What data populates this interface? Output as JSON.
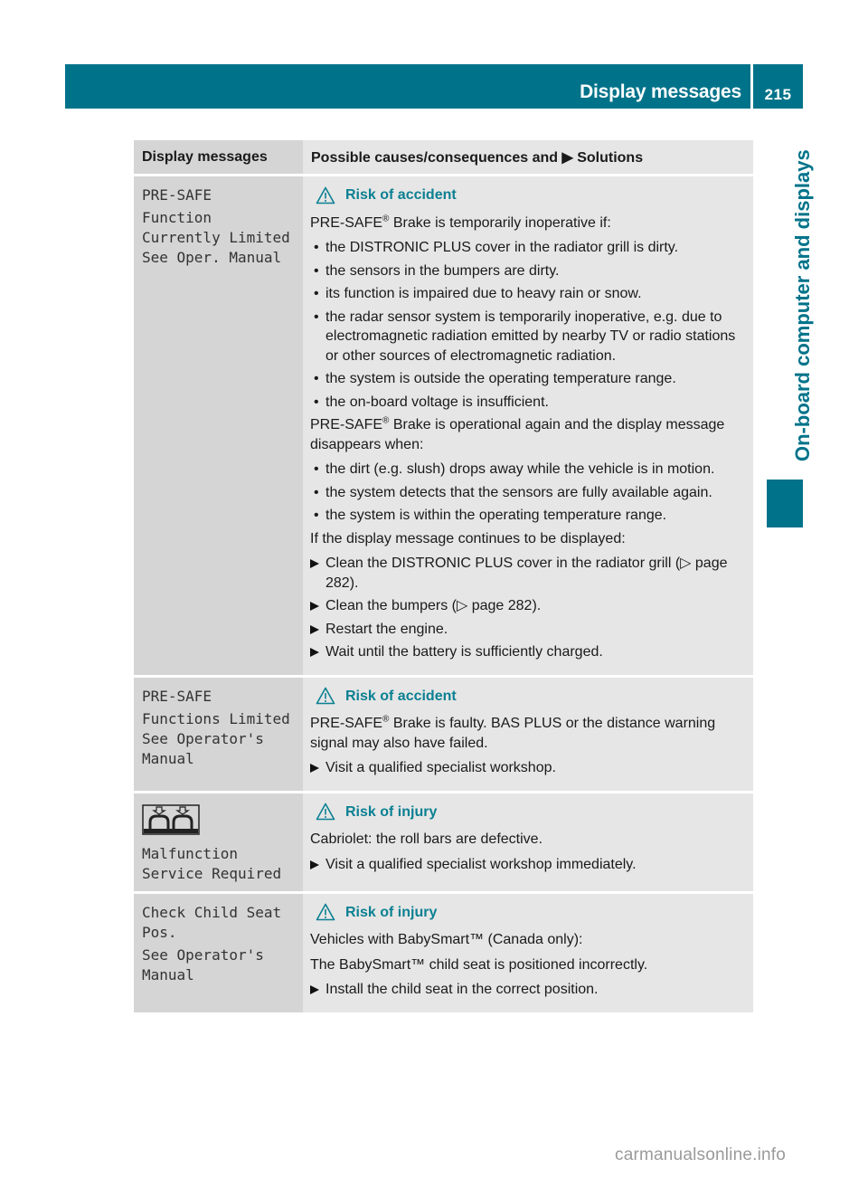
{
  "header": {
    "title": "Display messages",
    "page_number": "215",
    "section_tab": "On-board computer and displays",
    "accent_color": "#00738a"
  },
  "table": {
    "columns": [
      "Display messages",
      "Possible causes/consequences and ▶ Solutions"
    ],
    "rows": [
      {
        "display": [
          "PRE-SAFE",
          "Function Currently Limited See Oper. Manual"
        ],
        "warning": "Risk of accident",
        "intro": "PRE-SAFE® Brake is temporarily inoperative if:",
        "causes": [
          "the DISTRONIC PLUS cover in the radiator grill is dirty.",
          "the sensors in the bumpers are dirty.",
          "its function is impaired due to heavy rain or snow.",
          "the radar sensor system is temporarily inoperative, e.g. due to electromagnetic radiation emitted by nearby TV or radio stations or other sources of electromagnetic radiation.",
          "the system is outside the operating temperature range.",
          "the on-board voltage is insufficient."
        ],
        "intro2": "PRE-SAFE® Brake is operational again and the display message disappears when:",
        "conditions": [
          "the dirt (e.g. slush) drops away while the vehicle is in motion.",
          "the system detects that the sensors are fully available again.",
          "the system is within the operating temperature range."
        ],
        "intro3": "If the display message continues to be displayed:",
        "steps": [
          "Clean the DISTRONIC PLUS cover in the radiator grill (▷ page 282).",
          "Clean the bumpers (▷ page 282).",
          "Restart the engine.",
          "Wait until the battery is sufficiently charged."
        ]
      },
      {
        "display": [
          "PRE-SAFE",
          "Functions Limited See Operator's Manual"
        ],
        "warning": "Risk of accident",
        "text": "PRE-SAFE® Brake is faulty. BAS PLUS or the distance warning signal may also have failed.",
        "steps": [
          "Visit a qualified specialist workshop."
        ]
      },
      {
        "display_icon": "roll-bar-icon",
        "display": [
          "Malfunction Service Required"
        ],
        "warning": "Risk of injury",
        "text": "Cabriolet: the roll bars are defective.",
        "steps": [
          "Visit a qualified specialist workshop immediately."
        ]
      },
      {
        "display": [
          "Check Child Seat Pos.",
          "See Operator's Manual"
        ],
        "warning": "Risk of injury",
        "text": "Vehicles with BabySmart™ (Canada only):",
        "text2": "The BabySmart™ child seat is positioned incorrectly.",
        "steps": [
          "Install the child seat in the correct position."
        ]
      }
    ]
  },
  "watermark": "carmanualsonline.info"
}
